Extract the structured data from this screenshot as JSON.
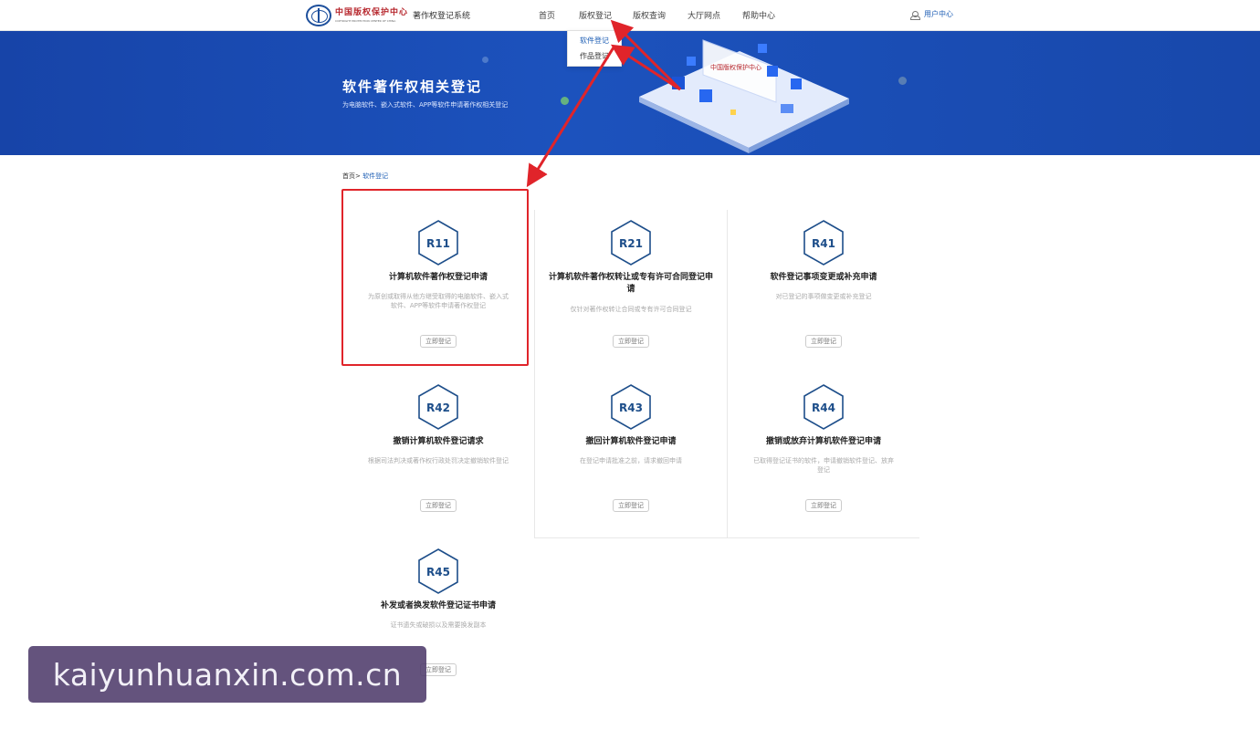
{
  "header": {
    "logo_cn": "中国版权保护中心",
    "logo_en": "COPYRIGHT PROTECTION CENTER OF CHINA",
    "system_title": "著作权登记系统",
    "nav": [
      "首页",
      "版权登记",
      "版权查询",
      "大厅网点",
      "帮助中心"
    ],
    "user_center": "用户中心"
  },
  "dropdown": {
    "items": [
      "软件登记",
      "作品登记"
    ],
    "active": "软件登记"
  },
  "banner": {
    "title": "软件著作权相关登记",
    "subtitle": "为电脑软件、嵌入式软件、APP等软件申请著作权相关登记",
    "illustration_label": "中国版权保护中心"
  },
  "breadcrumb": {
    "home": "首页>",
    "current": "软件登记"
  },
  "cards": [
    {
      "code": "R11",
      "title": "计算机软件著作权登记申请",
      "desc": "为原创或取得从他方继受取得的电脑软件、嵌入式软件、APP等软件申请著作权登记",
      "button": "立即登记"
    },
    {
      "code": "R21",
      "title": "计算机软件著作权转让或专有许可合同登记申请",
      "desc": "仅针对著作权转让合同或专有许可合同登记",
      "button": "立即登记"
    },
    {
      "code": "R41",
      "title": "软件登记事项变更或补充申请",
      "desc": "对已登记的事项做变更或补充登记",
      "button": "立即登记"
    },
    {
      "code": "R42",
      "title": "撤销计算机软件登记请求",
      "desc": "根据司法判决或著作权行政处罚决定撤销软件登记",
      "button": "立即登记"
    },
    {
      "code": "R43",
      "title": "撤回计算机软件登记申请",
      "desc": "在登记申请批准之前，请求撤回申请",
      "button": "立即登记"
    },
    {
      "code": "R44",
      "title": "撤销或放弃计算机软件登记申请",
      "desc": "已取得登记证书的软件，申请撤销软件登记、放弃登记",
      "button": "立即登记"
    },
    {
      "code": "R45",
      "title": "补发或者换发软件登记证书申请",
      "desc": "证书遗失或破损以及需要换发副本",
      "button": "立即登记"
    }
  ],
  "watermark": "kaiyunhuanxin.com.cn",
  "colors": {
    "accent": "#1f5fb5",
    "banner": "#1c52bd",
    "highlight": "#e0242a",
    "hex_code": "#1d4e8a"
  }
}
